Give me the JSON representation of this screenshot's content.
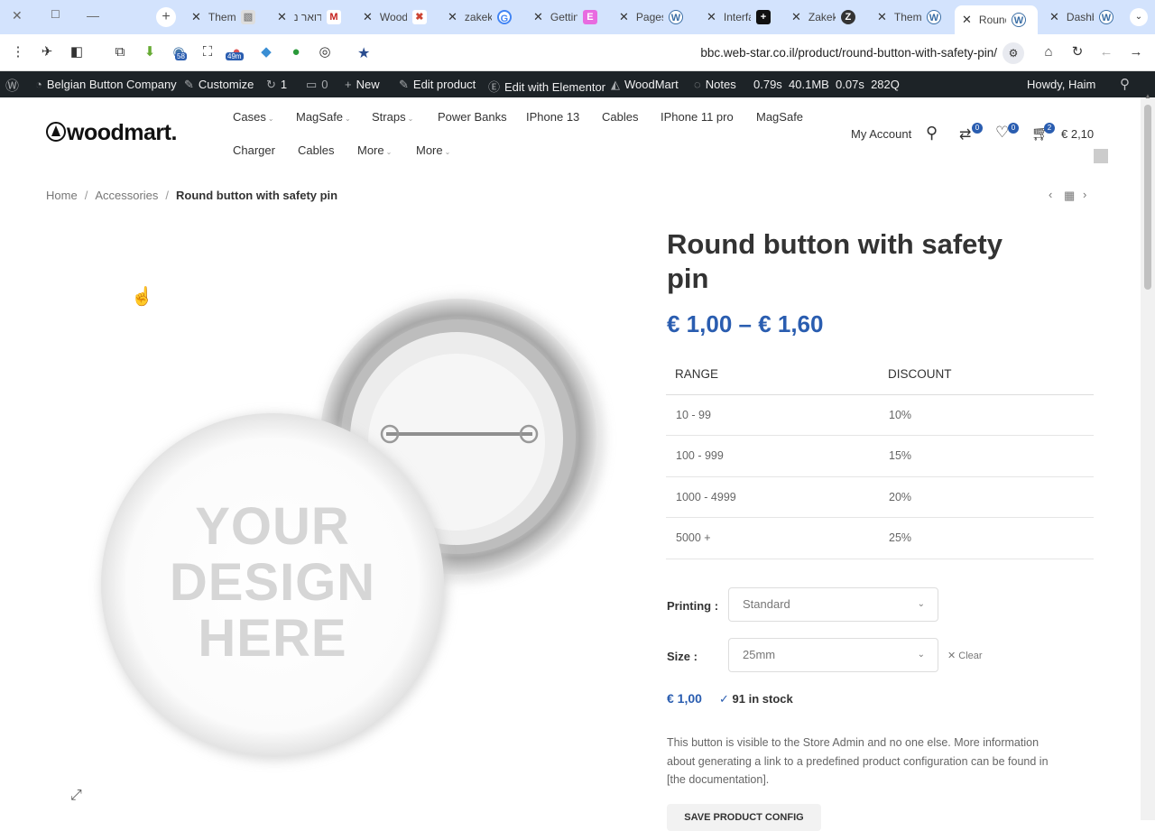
{
  "browser": {
    "tabs": [
      {
        "title": "Theme"
      },
      {
        "title": "דואר נ"
      },
      {
        "title": "Wood"
      },
      {
        "title": "zakek"
      },
      {
        "title": "Gettin"
      },
      {
        "title": "Pages"
      },
      {
        "title": "Interfa"
      },
      {
        "title": "Zakek"
      },
      {
        "title": "Theme"
      },
      {
        "title": "Round"
      },
      {
        "title": "Dashb"
      }
    ],
    "url": "bbc.web-star.co.il/product/round-button-with-safety-pin/",
    "extension_badges": {
      "ext1": "58",
      "ext2": "49m"
    }
  },
  "admin_bar": {
    "site_name": "Belgian Button Company",
    "customize": "Customize",
    "updates_count": "1",
    "comments_count": "0",
    "new": "New",
    "edit_product": "Edit product",
    "edit_elementor": "Edit with Elementor",
    "woodmart": "WoodMart",
    "notes": "Notes",
    "stats": "0.79s  40.1MB  0.07s  282Q",
    "howdy": "Howdy, Haim"
  },
  "header": {
    "logo": "woodmart.",
    "nav_row1": [
      "Cases",
      "MagSafe",
      "Straps",
      "Power Banks",
      "IPhone 13",
      "Cables",
      "IPhone 11 pro",
      "MagSafe"
    ],
    "nav_row2": [
      "Charger",
      "Cables",
      "More",
      "More"
    ],
    "my_account": "My Account",
    "compare_count": "0",
    "wishlist_count": "0",
    "cart_count": "2",
    "cart_total": "€ 2,10"
  },
  "breadcrumb": {
    "home": "Home",
    "category": "Accessories",
    "current": "Round button with safety pin"
  },
  "product": {
    "title": "Round button with safety pin",
    "price_range": "€ 1,00 – € 1,60",
    "image_text": [
      "YOUR",
      "DESIGN",
      "HERE"
    ],
    "discount_table": {
      "headers": [
        "RANGE",
        "DISCOUNT"
      ],
      "rows": [
        {
          "range": "10 - 99",
          "discount": "10%"
        },
        {
          "range": "100 - 999",
          "discount": "15%"
        },
        {
          "range": "1000 - 4999",
          "discount": "20%"
        },
        {
          "range": "5000 +",
          "discount": "25%"
        }
      ]
    },
    "printing_label": "Printing",
    "printing_value": "Standard",
    "size_label": "Size",
    "size_value": "25mm",
    "clear": "Clear",
    "variation_price": "€ 1,00",
    "stock": "91 in stock",
    "description": "This button is visible to the Store Admin and no one else. More information about generating a link to a predefined product configuration can be found in [the documentation].",
    "save_button": "SAVE PRODUCT CONFIG"
  },
  "colors": {
    "accent": "#2a5db0",
    "admin_bar": "#1d2327",
    "tabstrip": "#d3e3fd"
  }
}
